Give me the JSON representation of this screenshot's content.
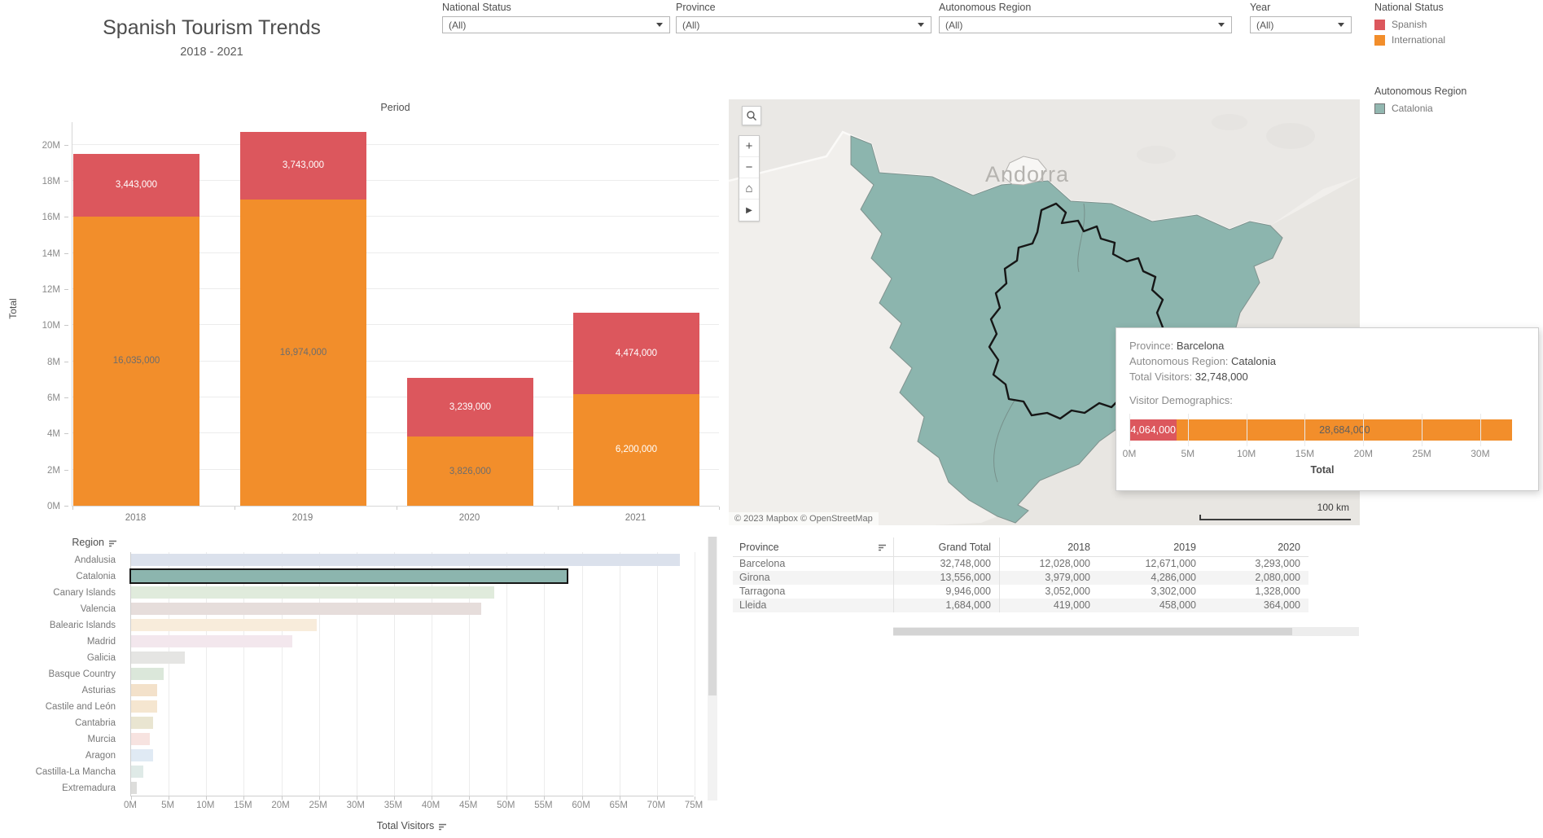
{
  "title": {
    "main": "Spanish Tourism Trends",
    "subtitle": "2018 - 2021"
  },
  "filters": [
    {
      "label": "National Status",
      "value": "(All)"
    },
    {
      "label": "Province",
      "value": "(All)"
    },
    {
      "label": "Autonomous Region",
      "value": "(All)"
    },
    {
      "label": "Year",
      "value": "(All)"
    }
  ],
  "legends": {
    "national_status": {
      "title": "National Status",
      "items": [
        {
          "label": "Spanish",
          "color": "#dc575d"
        },
        {
          "label": "International",
          "color": "#f28e2b"
        }
      ]
    },
    "autonomous_region": {
      "title": "Autonomous Region",
      "items": [
        {
          "label": "Catalonia",
          "color": "#92b7b0"
        }
      ]
    }
  },
  "chart_data": [
    {
      "id": "period_totals",
      "type": "bar",
      "stacked": true,
      "title": "Period",
      "ylabel": "Total",
      "categories": [
        "2018",
        "2019",
        "2020",
        "2021"
      ],
      "series": [
        {
          "name": "International",
          "color": "#f28e2b",
          "values": [
            16035000,
            16974000,
            3826000,
            6200000
          ],
          "label_colors": [
            "#6d6d6d",
            "#6d6d6d",
            "#6d6d6d",
            "#ffffff"
          ]
        },
        {
          "name": "Spanish",
          "color": "#dc575d",
          "values": [
            3443000,
            3743000,
            3239000,
            4474000
          ],
          "label_colors": [
            "#ffffff",
            "#ffffff",
            "#ffffff",
            "#ffffff"
          ]
        }
      ],
      "ylim": [
        0,
        21200000
      ],
      "yticks": [
        0,
        2000000,
        4000000,
        6000000,
        8000000,
        10000000,
        12000000,
        14000000,
        16000000,
        18000000,
        20000000
      ],
      "grid": true,
      "legend_position": "top-right"
    },
    {
      "id": "region_totals",
      "type": "bar",
      "orientation": "horizontal",
      "column_header": "Region",
      "xlabel": "Total Visitors",
      "xlim": [
        0,
        75000000
      ],
      "xticks": [
        0,
        5000000,
        10000000,
        15000000,
        20000000,
        25000000,
        30000000,
        35000000,
        40000000,
        45000000,
        50000000,
        55000000,
        60000000,
        65000000,
        70000000,
        75000000
      ],
      "bars": [
        {
          "label": "Andalusia",
          "value": 73000000,
          "color": "#dbe1ec",
          "highlighted": false
        },
        {
          "label": "Catalonia",
          "value": 57934000,
          "color": "#8cb5ae",
          "highlighted": true
        },
        {
          "label": "Canary Islands",
          "value": 48300000,
          "color": "#e0ebdc",
          "highlighted": false
        },
        {
          "label": "Valencia",
          "value": 46600000,
          "color": "#e6dddb",
          "highlighted": false
        },
        {
          "label": "Balearic Islands",
          "value": 24700000,
          "color": "#f8ecdb",
          "highlighted": false
        },
        {
          "label": "Madrid",
          "value": 21500000,
          "color": "#f3e7ed",
          "highlighted": false
        },
        {
          "label": "Galicia",
          "value": 7200000,
          "color": "#e5e5e3",
          "highlighted": false
        },
        {
          "label": "Basque Country",
          "value": 4300000,
          "color": "#dbe7da",
          "highlighted": false
        },
        {
          "label": "Asturias",
          "value": 3500000,
          "color": "#f3e1ca",
          "highlighted": false
        },
        {
          "label": "Castile and León",
          "value": 3500000,
          "color": "#f5e6d0",
          "highlighted": false
        },
        {
          "label": "Cantabria",
          "value": 2900000,
          "color": "#e9e5d1",
          "highlighted": false
        },
        {
          "label": "Murcia",
          "value": 2500000,
          "color": "#f7e3e0",
          "highlighted": false
        },
        {
          "label": "Aragon",
          "value": 2900000,
          "color": "#e0eaf4",
          "highlighted": false
        },
        {
          "label": "Castilla-La Mancha",
          "value": 1600000,
          "color": "#dfeae7",
          "highlighted": false
        },
        {
          "label": "Extremadura",
          "value": 800000,
          "color": "#dddddb",
          "highlighted": false
        }
      ]
    },
    {
      "id": "tooltip_demographics",
      "type": "bar",
      "stacked": true,
      "xlabel": "Total",
      "xlim": [
        0,
        33000000
      ],
      "xticks": [
        0,
        5000000,
        10000000,
        15000000,
        20000000,
        25000000,
        30000000
      ],
      "segments": [
        {
          "name": "Spanish",
          "value": 4064000,
          "color": "#dc575d",
          "label_color": "#ffffff"
        },
        {
          "name": "International",
          "value": 28684000,
          "color": "#f28e2b",
          "label_color": "#5f5f5f"
        }
      ]
    },
    {
      "id": "province_table",
      "type": "table",
      "headers": [
        "Province",
        "Grand Total",
        "2018",
        "2019",
        "2020"
      ],
      "rows": [
        {
          "province": "Barcelona",
          "values": [
            32748000,
            12028000,
            12671000,
            3293000
          ]
        },
        {
          "province": "Girona",
          "values": [
            13556000,
            3979000,
            4286000,
            2080000
          ]
        },
        {
          "province": "Tarragona",
          "values": [
            9946000,
            3052000,
            3302000,
            1328000
          ]
        },
        {
          "province": "Lleida",
          "values": [
            1684000,
            419000,
            458000,
            364000
          ]
        }
      ]
    }
  ],
  "map": {
    "region_label": "Andorra",
    "attribution": "© 2023 Mapbox  © OpenStreetMap",
    "scale_label": "100 km",
    "highlight_color": "#8cb5ae",
    "controls": {
      "zoom_in": "+",
      "zoom_out": "−",
      "home": "⌂",
      "pan": "▶"
    }
  },
  "tooltip": {
    "province_label": "Province:",
    "province_value": "Barcelona",
    "region_label": "Autonomous Region:",
    "region_value": "Catalonia",
    "total_label": "Total Visitors:",
    "total_value": "32,748,000",
    "demographics_label": "Visitor Demographics:"
  }
}
